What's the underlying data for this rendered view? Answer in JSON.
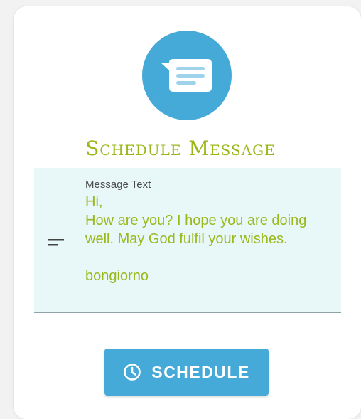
{
  "app": {
    "logo_icon": "message-bubble-icon",
    "title": "Schedule Message",
    "accent_color": "#9ab81b",
    "brand_color": "#45aad7"
  },
  "message_field": {
    "icon": "short-text-icon",
    "label": "Message Text",
    "value": "Hi,\nHow are you? I hope you are doing well. May God fulfil your wishes.\n\nbongiorno"
  },
  "schedule_button": {
    "icon": "clock-icon",
    "label": "SCHEDULE"
  }
}
